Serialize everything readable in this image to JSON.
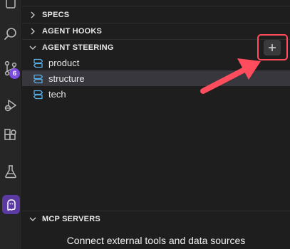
{
  "activity_bar": {
    "icons": [
      "explorer-icon",
      "search-icon",
      "source-control-icon",
      "run-debug-icon",
      "extensions-icon",
      "testing-icon",
      "kiro-ghost-icon"
    ],
    "source_control_badge": "6"
  },
  "panel": {
    "sections": {
      "specs": {
        "title": "SPECS",
        "expanded": false
      },
      "agent_hooks": {
        "title": "AGENT HOOKS",
        "expanded": false
      },
      "agent_steering": {
        "title": "AGENT STEERING",
        "expanded": true,
        "items": [
          {
            "label": "product",
            "selected": false
          },
          {
            "label": "structure",
            "selected": true
          },
          {
            "label": "tech",
            "selected": false
          }
        ],
        "add_button_icon": "plus-icon"
      },
      "mcp_servers": {
        "title": "MCP SERVERS",
        "expanded": true,
        "description": "Connect external tools and data sources"
      }
    }
  },
  "annotation": {
    "color": "#ff4d5e",
    "target": "agent-steering-add-button"
  },
  "colors": {
    "accent": "#7c4dde",
    "active_icon_bg": "#5b3ba3",
    "steering_icon": "#5aaee6",
    "selected_row": "#37373d"
  }
}
